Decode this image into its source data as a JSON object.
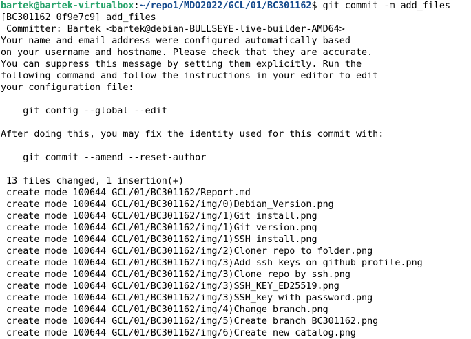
{
  "prompt": {
    "user_host": "bartek@bartek-virtualbox",
    "separator": ":",
    "path": "~/repo1/MDO2022/GCL/01/BC301162",
    "symbol": "$ ",
    "command": "git commit -m add_files"
  },
  "output_lines": [
    "[BC301162 0f9e7c9] add_files",
    " Committer: Bartek <bartek@debian-BULLSEYE-live-builder-AMD64>",
    "Your name and email address were configured automatically based",
    "on your username and hostname. Please check that they are accurate.",
    "You can suppress this message by setting them explicitly. Run the",
    "following command and follow the instructions in your editor to edit",
    "your configuration file:",
    "",
    "    git config --global --edit",
    "",
    "After doing this, you may fix the identity used for this commit with:",
    "",
    "    git commit --amend --reset-author",
    "",
    " 13 files changed, 1 insertion(+)",
    " create mode 100644 GCL/01/BC301162/Report.md",
    " create mode 100644 GCL/01/BC301162/img/0)Debian_Version.png",
    " create mode 100644 GCL/01/BC301162/img/1)Git install.png",
    " create mode 100644 GCL/01/BC301162/img/1)Git version.png",
    " create mode 100644 GCL/01/BC301162/img/1)SSH install.png",
    " create mode 100644 GCL/01/BC301162/img/2)Cloner repo to folder.png",
    " create mode 100644 GCL/01/BC301162/img/3)Add ssh keys on github profile.png",
    " create mode 100644 GCL/01/BC301162/img/3)Clone repo by ssh.png",
    " create mode 100644 GCL/01/BC301162/img/3)SSH_KEY_ED25519.png",
    " create mode 100644 GCL/01/BC301162/img/3)SSH_key with password.png",
    " create mode 100644 GCL/01/BC301162/img/4)Change branch.png",
    " create mode 100644 GCL/01/BC301162/img/5)Create branch BC301162.png",
    " create mode 100644 GCL/01/BC301162/img/6)Create new catalog.png"
  ],
  "colors": {
    "background": "#ffffff",
    "text": "#000000",
    "prompt_user": "#26a269",
    "prompt_path": "#12488b"
  }
}
